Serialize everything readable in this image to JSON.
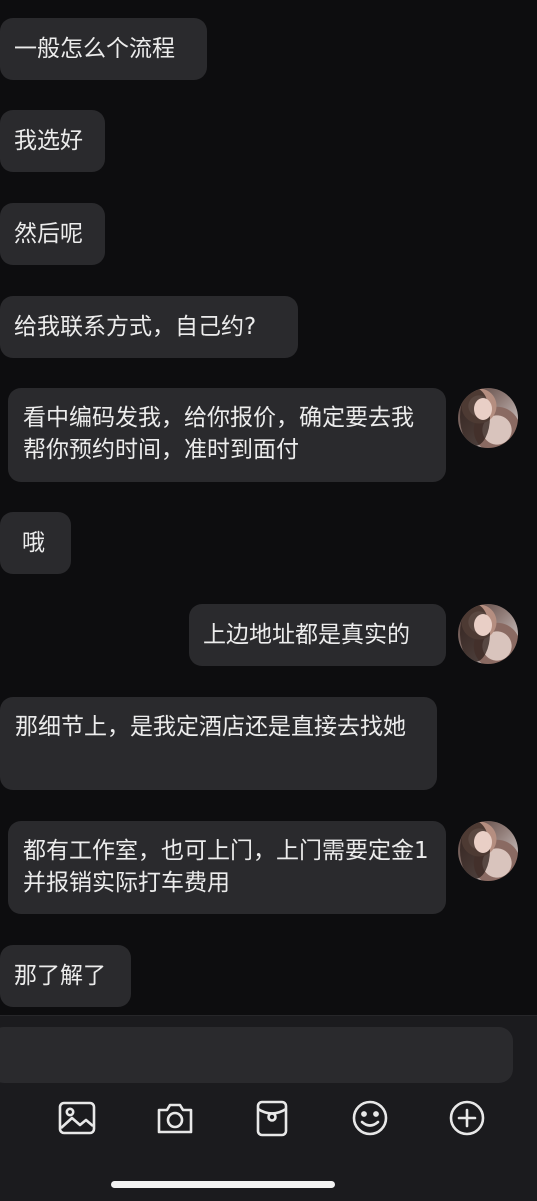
{
  "messages": [
    {
      "side": "left",
      "text": "一般怎么个流程"
    },
    {
      "side": "left",
      "text": "我选好"
    },
    {
      "side": "left",
      "text": "然后呢"
    },
    {
      "side": "left",
      "text": "给我联系方式，自己约?"
    },
    {
      "side": "right",
      "text": "看中编码发我，给你报价，确定要去我帮你预约时间，准时到面付"
    },
    {
      "side": "left",
      "text": "哦"
    },
    {
      "side": "right",
      "text": "上边地址都是真实的"
    },
    {
      "side": "left",
      "text": "那细节上，是我定酒店还是直接去找她"
    },
    {
      "side": "right",
      "text": "都有工作室，也可上门，上门需要定金1并报销实际打车费用"
    },
    {
      "side": "left",
      "text": "那了解了"
    }
  ],
  "composer": {
    "placeholder": "",
    "tools": [
      "image-icon",
      "camera-icon",
      "red-packet-icon",
      "emoji-icon",
      "add-icon"
    ]
  }
}
